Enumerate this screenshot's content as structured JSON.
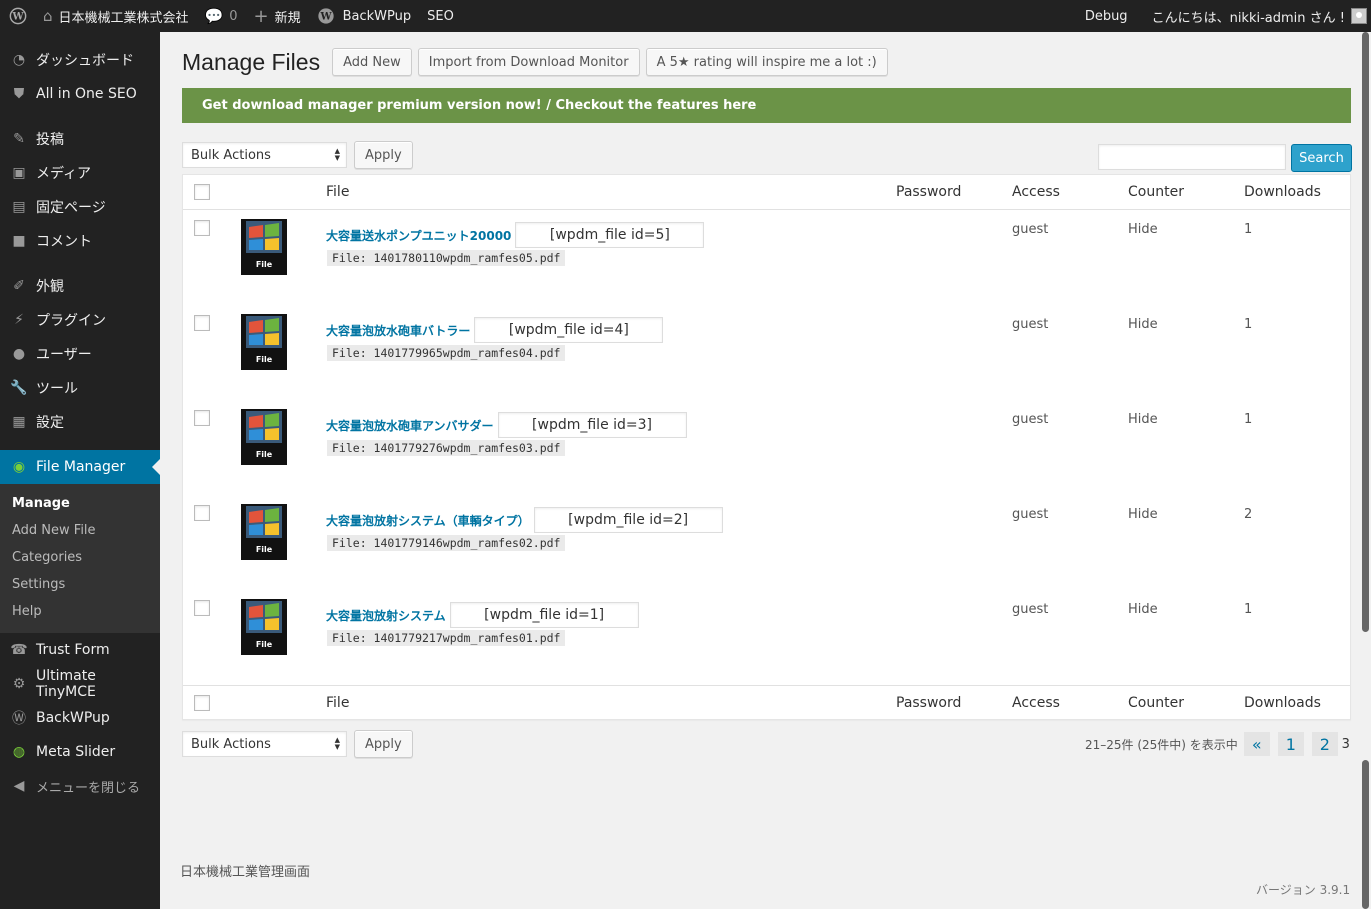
{
  "adminbar": {
    "site_name": "日本機械工業株式会社",
    "comments_count": "0",
    "new_label": "新規",
    "backwpup_label": "BackWPup",
    "seo_label": "SEO",
    "debug_label": "Debug",
    "greeting": "こんにちは、nikki-admin さん !"
  },
  "sidebar": {
    "items": [
      {
        "label": "ダッシュボード",
        "icon": "dashboard-icon"
      },
      {
        "label": "All in One SEO",
        "icon": "shield-icon"
      },
      {
        "label": "投稿",
        "icon": "pin-icon"
      },
      {
        "label": "メディア",
        "icon": "media-icon"
      },
      {
        "label": "固定ページ",
        "icon": "page-icon"
      },
      {
        "label": "コメント",
        "icon": "comment-icon"
      },
      {
        "label": "外観",
        "icon": "brush-icon"
      },
      {
        "label": "プラグイン",
        "icon": "plugin-icon"
      },
      {
        "label": "ユーザー",
        "icon": "user-icon"
      },
      {
        "label": "ツール",
        "icon": "wrench-icon"
      },
      {
        "label": "設定",
        "icon": "settings-icon"
      },
      {
        "label": "File Manager",
        "icon": "file-manager-icon"
      }
    ],
    "submenu": [
      "Manage",
      "Add New File",
      "Categories",
      "Settings",
      "Help"
    ],
    "more_items": [
      {
        "label": "Trust Form",
        "icon": "form-icon"
      },
      {
        "label": "Ultimate TinyMCE",
        "icon": "gear-icon"
      },
      {
        "label": "BackWPup",
        "icon": "wordpress-icon"
      },
      {
        "label": "Meta Slider",
        "icon": "slider-icon"
      }
    ],
    "collapse_label": "メニューを閉じる"
  },
  "header": {
    "title": "Manage Files",
    "add_new": "Add New",
    "import": "Import from Download Monitor",
    "rating": "A 5★ rating will inspire me a lot :)"
  },
  "promo": "Get download manager premium version now! / Checkout the features here",
  "controls": {
    "bulk_actions": "Bulk Actions",
    "apply": "Apply",
    "search_button": "Search",
    "search_value": ""
  },
  "table": {
    "columns": {
      "file": "File",
      "password": "Password",
      "access": "Access",
      "counter": "Counter",
      "downloads": "Downloads"
    },
    "thumb_label": "File",
    "rows": [
      {
        "title": "大容量送水ポンプユニット20000",
        "shortcode": "[wpdm_file id=5]",
        "filename": "File: 1401780110wpdm_ramfes05.pdf",
        "access": "guest",
        "counter": "Hide",
        "downloads": "1"
      },
      {
        "title": "大容量泡放水砲車バトラー",
        "shortcode": "[wpdm_file id=4]",
        "filename": "File: 1401779965wpdm_ramfes04.pdf",
        "access": "guest",
        "counter": "Hide",
        "downloads": "1"
      },
      {
        "title": "大容量泡放水砲車アンバサダー",
        "shortcode": "[wpdm_file id=3]",
        "filename": "File: 1401779276wpdm_ramfes03.pdf",
        "access": "guest",
        "counter": "Hide",
        "downloads": "1"
      },
      {
        "title": "大容量泡放射システム（車輌タイプ）",
        "shortcode": "[wpdm_file id=2]",
        "filename": "File: 1401779146wpdm_ramfes02.pdf",
        "access": "guest",
        "counter": "Hide",
        "downloads": "2"
      },
      {
        "title": "大容量泡放射システム",
        "shortcode": "[wpdm_file id=1]",
        "filename": "File: 1401779217wpdm_ramfes01.pdf",
        "access": "guest",
        "counter": "Hide",
        "downloads": "1"
      }
    ]
  },
  "pagination": {
    "count_text": "21–25件 (25件中) を表示中",
    "prev": "«",
    "pages": [
      "1",
      "2",
      "3"
    ],
    "current": "3"
  },
  "footer": {
    "left": "日本機械工業管理画面",
    "version": "バージョン 3.9.1"
  },
  "colors": {
    "accent": "#0074a2",
    "promo": "#6b9347",
    "search_button": "#2ea2cc"
  }
}
